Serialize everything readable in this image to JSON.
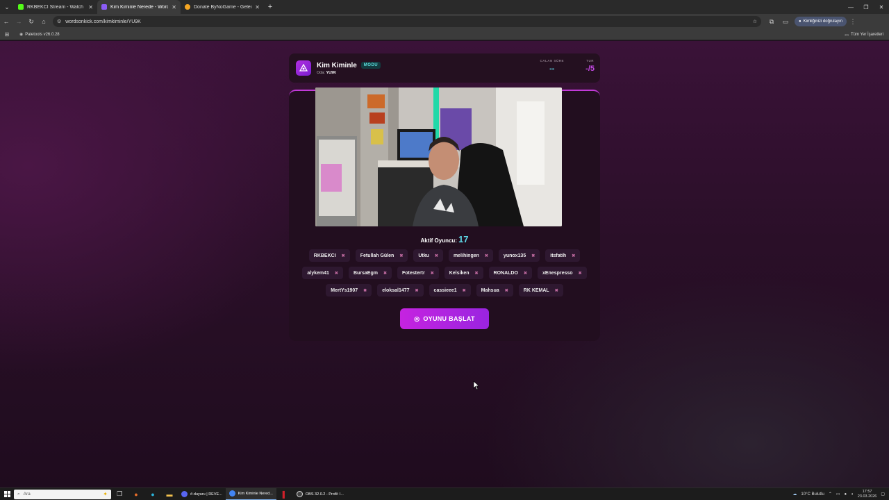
{
  "browser": {
    "tabs": [
      {
        "title": "RKBEKCI Stream - Watch Live o",
        "favicon_color": "#53fc18",
        "active": false
      },
      {
        "title": "Kim Kiminle Nerede - Words O",
        "favicon_color": "#8b5cf6",
        "active": true
      },
      {
        "title": "Donate ByNoGame - Gelen/Gid",
        "favicon_color": "#f5a623",
        "active": false
      }
    ],
    "url": "wordsonkick.com/kimkiminle/YU9K",
    "profile_label": "Kimliğinizi doğrulayın",
    "bookmark": "Paletools v26.0.28",
    "all_bookmarks": "Tüm Yer İşaretleri"
  },
  "game": {
    "title": "Kim Kiminle",
    "mode_badge": "MODU",
    "room_label": "Oda:",
    "room_code": "YU9K",
    "time_label": "CALAN SÜRE",
    "time_value": "--",
    "round_label": "TUR",
    "round_value": "-/5",
    "active_label": "Aktif Oyuncu:",
    "active_count": "17",
    "player_rows": [
      [
        "RKBEKCI",
        "Fetullah Gülen",
        "Utku",
        "melihingen",
        "yunox135",
        "itsfatih"
      ],
      [
        "alykem41",
        "BursaEgm",
        "Fotestertr",
        "Kelsiken",
        "RONALDO",
        "xEnespresso"
      ],
      [
        "MertYs1907",
        "eloksal1477",
        "cassieee1",
        "Mahsua",
        "RK KEMAL"
      ]
    ],
    "start_button": "OYUNU BAŞLAT"
  },
  "taskbar": {
    "search_placeholder": "Ara",
    "apps": [
      {
        "label": "#-duyuru | REVE...",
        "color": "#5865f2",
        "active": false
      },
      {
        "label": "Kim Kiminle Nered...",
        "color": "#4285f4",
        "active": true
      },
      {
        "label": "OBS 32.0.2 - Profil: I...",
        "color": "#444444",
        "active": false
      }
    ],
    "weather": "10°C  Bulutlu",
    "time": "17:57",
    "date": "23.03.2026"
  },
  "colors": {
    "accent": "#c23ad8",
    "cyan": "#5ed8e6"
  }
}
